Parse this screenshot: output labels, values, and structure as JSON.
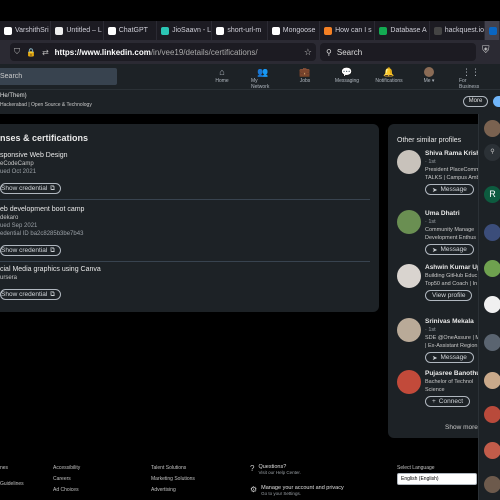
{
  "browser": {
    "tabs": [
      {
        "label": "VarshithSri",
        "color": "#ffffff",
        "active": false
      },
      {
        "label": "Untitled – L",
        "color": "#eeeeee",
        "active": false
      },
      {
        "label": "ChatGPT",
        "color": "#ffffff",
        "active": false
      },
      {
        "label": "JioSaavn - L",
        "color": "#2bc5b4",
        "active": false
      },
      {
        "label": "short-url-m",
        "color": "#ffffff",
        "active": false
      },
      {
        "label": "Mongoose",
        "color": "#ffffff",
        "active": false
      },
      {
        "label": "How can I s",
        "color": "#f48024",
        "active": false
      },
      {
        "label": "Database A",
        "color": "#13aa52",
        "active": false
      },
      {
        "label": "hackquest.io/e",
        "color": "#444444",
        "active": false
      },
      {
        "label": "in",
        "color": "#0a66c2",
        "active": true
      }
    ],
    "url_host": "https://www.linkedin.com",
    "url_path": "/in/vee19/details/certifications/",
    "search_placeholder": "Search"
  },
  "linkedin_nav": {
    "search_placeholder": "Search",
    "items": [
      {
        "label": "Home",
        "icon": "home-icon",
        "glyph": "⌂"
      },
      {
        "label": "My Network",
        "icon": "network-icon",
        "glyph": "👥"
      },
      {
        "label": "Jobs",
        "icon": "jobs-icon",
        "glyph": "💼"
      },
      {
        "label": "Messaging",
        "icon": "messaging-icon",
        "glyph": "💬"
      },
      {
        "label": "Notifications",
        "icon": "bell-icon",
        "glyph": "🔔"
      },
      {
        "label": "Me ▾",
        "icon": "avatar",
        "glyph": ""
      },
      {
        "label": "For Business ▾",
        "icon": "grid-icon",
        "glyph": "⋮⋮"
      }
    ]
  },
  "profile_header": {
    "pronouns": "He/Them)",
    "description": "Hackerabad | Open Source & Technology",
    "more_label": "More"
  },
  "certifications": {
    "title": "nses & certifications",
    "items": [
      {
        "name": "sponsive Web Design",
        "issuer": "eCodeCamp",
        "issued": "ued Oct 2021",
        "credential_id": "",
        "button": "Show credential"
      },
      {
        "name": "eb development boot camp",
        "issuer": "dekaro",
        "issued": "ued Sep 2021",
        "credential_id": "edential ID ba2c8285b3be7b43",
        "button": "Show credential"
      },
      {
        "name": "cial Media graphics using Canva",
        "issuer": "ursera",
        "issued": "",
        "credential_id": "",
        "button": "Show credential"
      }
    ]
  },
  "sidebar": {
    "title": "Other similar profiles",
    "people": [
      {
        "name": "Shiva Rama Krishn",
        "degree": "· 1st",
        "headline": [
          "President PlaceComm",
          "TALKS | Campus Amb"
        ],
        "button": "Message",
        "button_icon": "send-icon",
        "avatar_color": "#c8c2bb"
      },
      {
        "name": "Uma Dhatri",
        "degree": "· 1st",
        "headline": [
          "Community Manage",
          "Development Enthus"
        ],
        "button": "Message",
        "button_icon": "send-icon",
        "avatar_color": "#6a8f52"
      },
      {
        "name": "Ashwin Kumar Up",
        "degree": "",
        "headline": [
          "Building GitHub Educ",
          "Top50 and Coach | In"
        ],
        "button": "View profile",
        "button_icon": "",
        "avatar_color": "#d9d4cf"
      },
      {
        "name": "Srinivas Mekala",
        "degree": "· 1st",
        "headline": [
          "SDE @OneAssure | M",
          "| Ex-Assistant Region"
        ],
        "button": "Message",
        "button_icon": "send-icon",
        "avatar_color": "#b9aa98"
      },
      {
        "name": "Pujasree Banothu",
        "degree": "",
        "headline": [
          "Bachelor of Technol",
          "Science"
        ],
        "button": "Connect",
        "button_icon": "add-person-icon",
        "avatar_color": "#c24a3a"
      }
    ],
    "show_more": "Show more"
  },
  "footer": {
    "col1": [
      "nes",
      "",
      "Guidelines"
    ],
    "col2": [
      "Accessibility",
      "Careers",
      "Ad Choices"
    ],
    "col3": [
      "Talent Solutions",
      "Marketing Solutions",
      "Advertising"
    ],
    "questions_title": "Questions?",
    "questions_sub": "Visit our Help Center.",
    "manage_title": "Manage your account and privacy",
    "manage_sub": "Go to your Settings.",
    "language_label": "Select Language",
    "language_value": "English (English)"
  }
}
